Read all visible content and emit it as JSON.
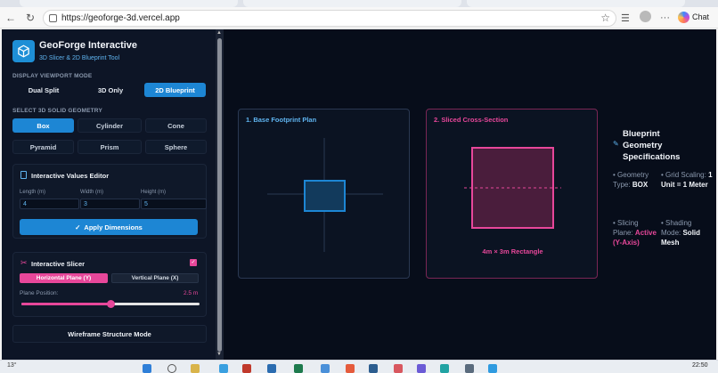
{
  "browser": {
    "url": "https://geoforge-3d.vercel.app",
    "chat_label": "Chat"
  },
  "app": {
    "title": "GeoForge Interactive",
    "subtitle": "3D Slicer & 2D Blueprint Tool",
    "viewport_label": "DISPLAY VIEWPORT MODE",
    "viewport_modes": [
      "Dual Split",
      "3D Only",
      "2D Blueprint"
    ],
    "viewport_active": "2D Blueprint",
    "geometry_label": "SELECT 3D SOLID GEOMETRY",
    "geometries": [
      "Box",
      "Cylinder",
      "Cone",
      "Pyramid",
      "Prism",
      "Sphere"
    ],
    "geometry_active": "Box",
    "editor": {
      "title": "Interactive Values Editor",
      "length_label": "Length (m)",
      "width_label": "Width (m)",
      "height_label": "Height (m)",
      "length_value": "4",
      "width_value": "3",
      "height_value": "5",
      "apply_label": "Apply Dimensions"
    },
    "slicer": {
      "title": "Interactive Slicer",
      "enabled": true,
      "horizontal_label": "Horizontal Plane (Y)",
      "vertical_label": "Vertical Plane (X)",
      "plane_position_label": "Plane Position:",
      "plane_position_value": "2.5 m",
      "slider_fraction": 0.5
    },
    "wireframe_label": "Wireframe Structure Mode",
    "views": {
      "footprint_title": "1. Base Footprint Plan",
      "section_title": "2. Sliced Cross-Section",
      "section_caption": "4m × 3m Rectangle"
    },
    "specs": {
      "title_line1": "Blueprint",
      "title_line2": "Geometry",
      "title_line3": "Specifications",
      "geometry_type_label": "• Geometry Type:",
      "geometry_type_value": "BOX",
      "grid_scaling_label": "• Grid Scaling:",
      "grid_scaling_value": "1 Unit = 1 Meter",
      "slicing_plane_label": "• Slicing Plane:",
      "slicing_plane_value": "Active (Y-Axis)",
      "shading_mode_label": "• Shading Mode:",
      "shading_mode_value": "Solid Mesh"
    }
  },
  "taskbar": {
    "weather": "13°",
    "time": "22:50"
  },
  "colors": {
    "accent_blue": "#1d86d4",
    "accent_pink": "#e7479a",
    "background": "#070d1a"
  }
}
